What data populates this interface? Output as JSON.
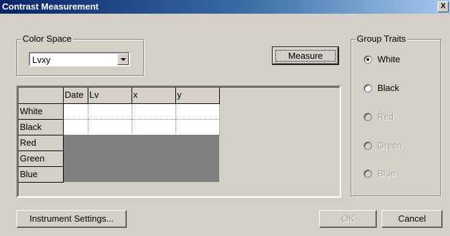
{
  "window": {
    "title": "Contrast Measurement",
    "close": "X"
  },
  "color_space": {
    "group_label": "Color Space",
    "selected": "Lvxy"
  },
  "measure_button": "Measure",
  "group_traits": {
    "label": "Group Traits",
    "options": [
      {
        "label": "White",
        "checked": true,
        "enabled": true
      },
      {
        "label": "Black",
        "checked": false,
        "enabled": true
      },
      {
        "label": "Red",
        "checked": false,
        "enabled": false
      },
      {
        "label": "Green",
        "checked": false,
        "enabled": false
      },
      {
        "label": "Blue",
        "checked": false,
        "enabled": false
      }
    ]
  },
  "table": {
    "columns": [
      "",
      "Date",
      "Lv",
      "x",
      "y"
    ],
    "rows": [
      "White",
      "Black",
      "Red",
      "Green",
      "Blue"
    ]
  },
  "footer": {
    "instrument_settings": "Instrument Settings...",
    "ok": "OK",
    "cancel": "Cancel"
  }
}
